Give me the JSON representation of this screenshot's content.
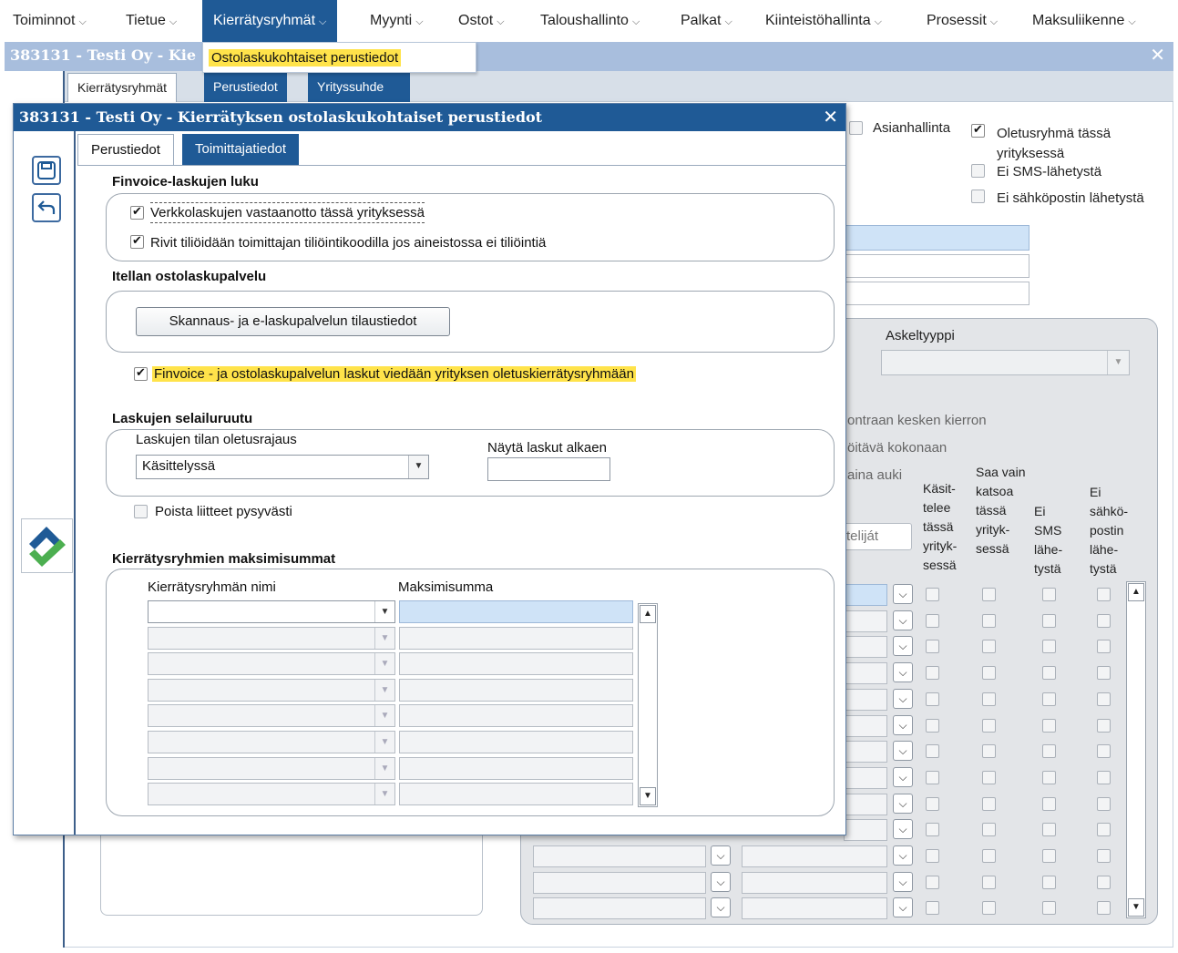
{
  "menu": {
    "items": [
      "Toiminnot",
      "Tietue",
      "Kierrätysryhmät",
      "Myynti",
      "Ostot",
      "Taloushallinto",
      "Palkat",
      "Kiinteistöhallinta",
      "Prosessit",
      "Maksuliikenne"
    ],
    "dropdown_item": "Ostolaskukohtaiset perustiedot"
  },
  "bg_window": {
    "title": "383131 - Testi Oy - Kie",
    "tabs": [
      "Kierrätysryhmät",
      "Perustiedot",
      "Yrityssuhde"
    ],
    "asianhallinta": "Asianhallinta",
    "oletusryhma": "Oletusryhmä tässä yrityksessä",
    "ei_sms": "Ei SMS-lähetystä",
    "ei_sahkoposti": "Ei sähköpostin lähetystä",
    "askeltyyppi": "Askeltyyppi",
    "text_kierron": "ontraan kesken kierron",
    "text_kokonaan": "öitävä kokonaan",
    "text_auki": "aina auki",
    "btn_kasittelijat": "teliját",
    "col_kasittelee": "Käsit- telee tässä yrityk- sessä",
    "col_saa_vain": "Saa vain katsoa tässä yrityk- sessä",
    "col_ei_sms": "Ei SMS lähe- tystä",
    "col_ei_sahko": "Ei sähkö- postin lähe- tystä"
  },
  "modal": {
    "title": "383131 - Testi Oy - Kierrätyksen ostolaskukohtaiset perustiedot",
    "tabs": [
      "Perustiedot",
      "Toimittajatiedot"
    ],
    "finvoice": {
      "title": "Finvoice-laskujen luku",
      "cb1": "Verkkolaskujen vastaanotto tässä yrityksessä",
      "cb2": "Rivit tiliöidään toimittajan tiliöintikoodilla jos aineistossa ei tiliöintiä"
    },
    "itella": {
      "title": "Itellan ostolaskupalvelu",
      "button": "Skannaus- ja e-laskupalvelun tilaustiedot",
      "cb": "Finvoice - ja ostolaskupalvelun laskut viedään yrityksen oletuskierrätysryhmään"
    },
    "selailu": {
      "title": "Laskujen selailuruutu",
      "status_label": "Laskujen tilan oletusrajaus",
      "status_value": "Käsittelyssä",
      "date_label": "Näytä laskut alkaen",
      "date_value": "",
      "delete_cb": "Poista liitteet pysyvästi"
    },
    "maksimi": {
      "title": "Kierrätysryhmien maksimisummat",
      "col_name": "Kierrätysryhmän nimi",
      "col_sum": "Maksimisumma"
    }
  },
  "colors": {
    "accent": "#1f5a96",
    "highlight": "#ffe34a"
  }
}
